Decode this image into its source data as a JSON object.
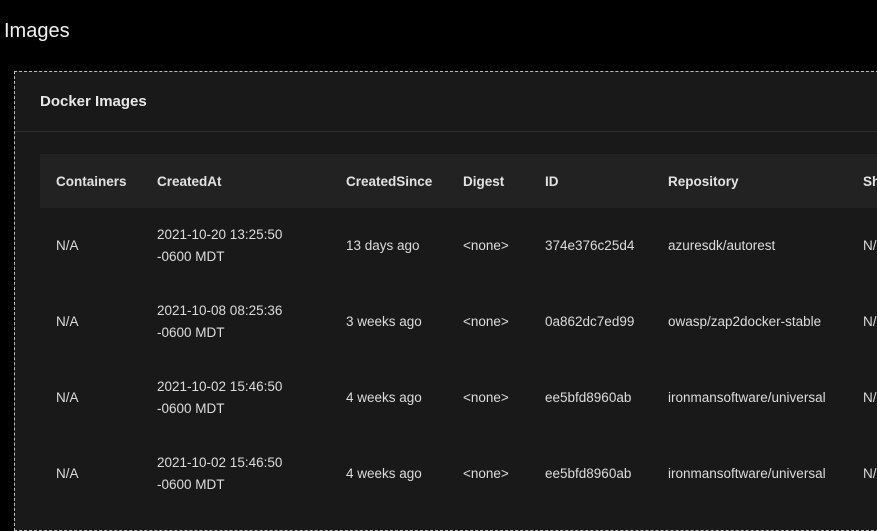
{
  "page": {
    "title": "Images"
  },
  "card": {
    "title": "Docker Images"
  },
  "table": {
    "columns": [
      "Containers",
      "CreatedAt",
      "CreatedSince",
      "Digest",
      "ID",
      "Repository",
      "Sh"
    ],
    "rows": [
      {
        "containers": "N/A",
        "created_at_date": "2021-10-20 13:25:50",
        "created_at_tz": "-0600 MDT",
        "created_since": "13 days ago",
        "digest": "<none>",
        "id": "374e376c25d4",
        "repository": "azuresdk/autorest",
        "shared": "N/"
      },
      {
        "containers": "N/A",
        "created_at_date": "2021-10-08 08:25:36",
        "created_at_tz": "-0600 MDT",
        "created_since": "3 weeks ago",
        "digest": "<none>",
        "id": "0a862dc7ed99",
        "repository": "owasp/zap2docker-stable",
        "shared": "N/"
      },
      {
        "containers": "N/A",
        "created_at_date": "2021-10-02 15:46:50",
        "created_at_tz": "-0600 MDT",
        "created_since": "4 weeks ago",
        "digest": "<none>",
        "id": "ee5bfd8960ab",
        "repository": "ironmansoftware/universal",
        "shared": "N/"
      },
      {
        "containers": "N/A",
        "created_at_date": "2021-10-02 15:46:50",
        "created_at_tz": "-0600 MDT",
        "created_since": "4 weeks ago",
        "digest": "<none>",
        "id": "ee5bfd8960ab",
        "repository": "ironmansoftware/universal",
        "shared": "N/"
      }
    ]
  },
  "colors": {
    "page_background": "#000000",
    "card_background": "#191919",
    "header_row_background": "#222222",
    "text": "#e6e6e6"
  }
}
